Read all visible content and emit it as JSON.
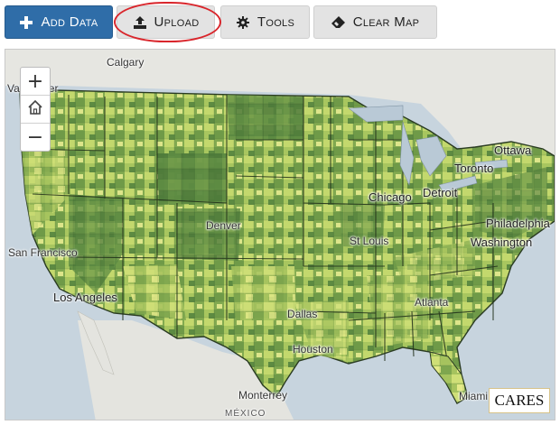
{
  "toolbar": {
    "add_data_label": "Add Data",
    "upload_label": "Upload",
    "tools_label": "Tools",
    "clear_map_label": "Clear Map",
    "icons": {
      "add_data": "plus-icon",
      "upload": "upload-icon",
      "tools": "gear-icon",
      "clear_map": "eraser-icon"
    },
    "colors": {
      "primary": "#2f6da8",
      "secondary": "#e3e3e3",
      "highlight": "#d9262c"
    }
  },
  "map_controls": {
    "zoom_in": "+",
    "home_icon": "home-icon",
    "zoom_out": "−"
  },
  "map": {
    "labels": {
      "calgary": "Calgary",
      "vancouver": "Vancouver",
      "ottawa": "Ottawa",
      "toronto": "Toronto",
      "chicago": "Chicago",
      "detroit": "Detroit",
      "denver": "Denver",
      "san_francisco": "San Francisco",
      "st_louis": "St Louis",
      "philadelphia": "Philadelphia",
      "washington": "Washington",
      "los_angeles": "Los Angeles",
      "dallas": "Dallas",
      "atlanta": "Atlanta",
      "houston": "Houston",
      "monterrey": "Monterrey",
      "miami": "Miami",
      "mexico": "MÉXICO"
    },
    "choropleth_colors": [
      "#4a7a3c",
      "#5f8e45",
      "#7aa34f",
      "#93b85a",
      "#aecb62",
      "#cbdc72",
      "#e6ea86"
    ]
  },
  "attribution": {
    "logo_text": "CARES"
  }
}
